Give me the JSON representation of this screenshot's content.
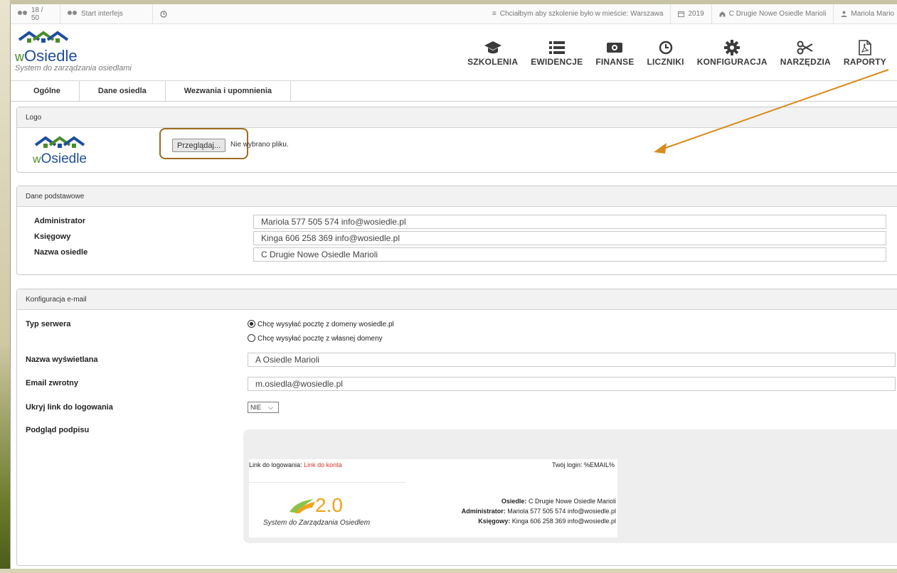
{
  "topbar": {
    "users_count": "18 / 50",
    "start": "Start interfejs",
    "city_pref": "Chciałbym aby szkolenie było w mieście: Warszawa",
    "year": "2019",
    "estate": "C Drugie Nowe Osiedle Marioli",
    "user": "Mariola Mario"
  },
  "brand": {
    "name_prefix": "w",
    "name": "Osiedle",
    "subtitle": "System do zarządzania osiedlami"
  },
  "nav": [
    {
      "label": "SZKOLENIA",
      "icon": "graduation-cap-icon"
    },
    {
      "label": "EWIDENCJE",
      "icon": "list-icon"
    },
    {
      "label": "FINANSE",
      "icon": "money-icon"
    },
    {
      "label": "LICZNIKI",
      "icon": "clock-icon"
    },
    {
      "label": "KONFIGURACJA",
      "icon": "gear-icon"
    },
    {
      "label": "NARZĘDZIA",
      "icon": "scissors-icon"
    },
    {
      "label": "RAPORTY",
      "icon": "pdf-icon"
    }
  ],
  "tabs": [
    "Ogólne",
    "Dane osiedla",
    "Wezwania i upomnienia"
  ],
  "logo_panel": {
    "title": "Logo",
    "logo_prefix": "w",
    "logo_text": "Osiedle",
    "browse_label": "Przeglądaj...",
    "file_status": "Nie wybrano pliku."
  },
  "basic_panel": {
    "title": "Dane podstawowe",
    "fields": [
      {
        "label": "Administrator",
        "value": "Mariola 577 505 574 info@wosiedle.pl"
      },
      {
        "label": "Księgowy",
        "value": "Kinga 606 258 369 info@wosiedle.pl"
      },
      {
        "label": "Nazwa osiedle",
        "value": "C Drugie Nowe Osiedle Marioli"
      }
    ]
  },
  "email_panel": {
    "title": "Konfiguracja e-mail",
    "server_label": "Typ serwera",
    "radio_1": "Chcę wysyłać pocztę z domeny wosiedle.pl",
    "radio_2": "Chcę wysyłać pocztę z własnej domeny",
    "display_label": "Nazwa wyświetlana",
    "display_value": "A Osiedle Marioli",
    "return_label": "Email zwrotny",
    "return_value": "m.osiedla@wosiedle.pl",
    "hide_label": "Ukryj link do logowania",
    "hide_value": "NIE",
    "preview_label": "Podgląd podpisu"
  },
  "signature": {
    "link_prefix": "Link do logowania:",
    "link_text": "Link do konta",
    "login": "Twój login: %EMAIL%",
    "version": "2.0",
    "tagline": "System do Zarządzania Osiedlem",
    "estate_label": "Osiedle:",
    "estate_value": "C Drugie Nowe Osiedle Marioli",
    "admin_label": "Administrator:",
    "admin_value": "Mariola 577 505 574 info@wosiedle.pl",
    "acc_label": "Księgowy:",
    "acc_value": "Kinga 606 258 369 info@wosiedle.pl"
  },
  "colors": {
    "brand_blue": "#1f4e9c",
    "brand_green": "#4a8c2a",
    "highlight_brown": "#9c6b1f",
    "arrow_orange": "#d98a1c",
    "link_red": "#d9342b"
  }
}
